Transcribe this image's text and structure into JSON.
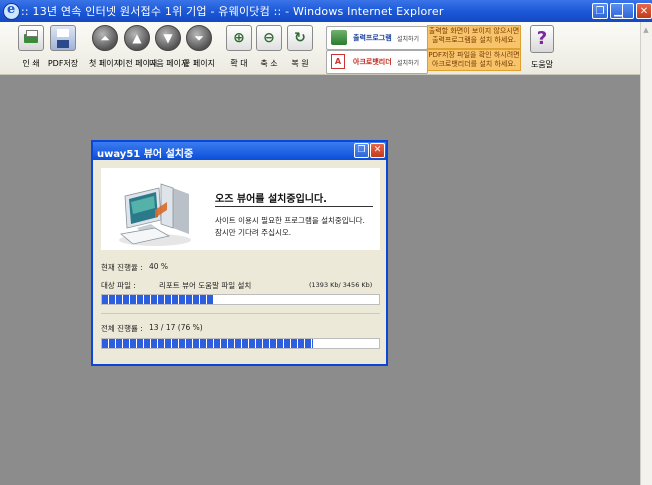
{
  "window": {
    "title": ":: 13년 연속 인터넷 원서접수 1위 기업 - 유웨이닷컴 :: - Windows Internet Explorer"
  },
  "toolbar": {
    "print_label": "인 쇄",
    "pdf_label": "PDF저장",
    "first_label": "첫 페이지",
    "prev_label": "이전 페이지",
    "next_label": "다음 페이지",
    "last_label": "끝 페이지",
    "zoom_in_label": "확 대",
    "zoom_out_label": "축 소",
    "restore_label": "복 원",
    "print_program_name": "출력프로그램",
    "print_program_action": "설치하기",
    "print_program_note": "출력할 화면이 보이지 않으시면 출력프로그램을 설치 하세요.",
    "acrobat_name": "아크로뱃리더",
    "acrobat_action": "설치하기",
    "acrobat_note": "PDF저장 파일을 확인 하시려면 아크로뱃리더를 설치 하세요.",
    "help_label": "도움말",
    "help_glyph": "?"
  },
  "dialog": {
    "title": "uway51 뷰어 설치중",
    "headline": "오즈 뷰어를 설치중입니다.",
    "desc_line1": "사이트 이용시 필요한 프로그램을 설치중입니다.",
    "desc_line2": "잠시만 기다려 주십시오.",
    "current_progress_label": "현재 진행율 :",
    "current_progress_value": "40 %",
    "target_file_label": "대상 파일 :",
    "target_file_name": "리포트 뷰어 도움말 파일 설치",
    "target_file_size": "(1393 Kb/ 3456 Kb)",
    "current_progress_fraction": 0.4,
    "overall_progress_label": "전체 진행률 :",
    "overall_progress_value": "13 / 17 (76 %)",
    "overall_progress_fraction": 0.76
  },
  "colors": {
    "titlebar": "#1b57d6",
    "progress_fill": "#2d5ee0",
    "workspace": "#8c8c8c",
    "dialog_bg": "#ece9d8"
  }
}
